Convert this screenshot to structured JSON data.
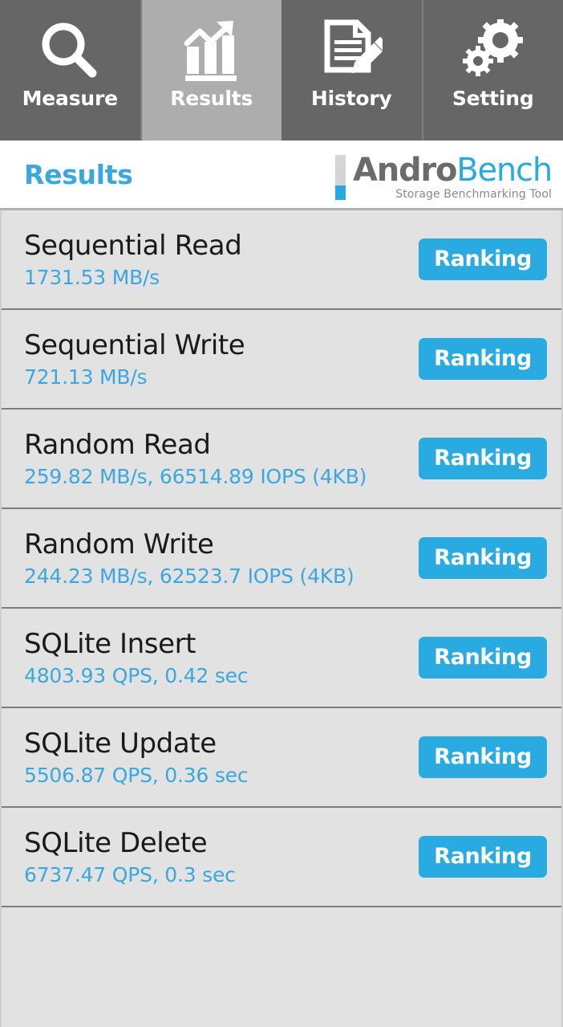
{
  "tabs": [
    {
      "label": "Measure",
      "icon": "magnifier-icon",
      "active": false
    },
    {
      "label": "Results",
      "icon": "bar-chart-icon",
      "active": true
    },
    {
      "label": "History",
      "icon": "document-pencil-icon",
      "active": false
    },
    {
      "label": "Setting",
      "icon": "gears-icon",
      "active": false
    }
  ],
  "header": {
    "title": "Results",
    "logo": {
      "word_primary": "Andro",
      "word_secondary": "Bench",
      "subtitle": "Storage Benchmarking Tool"
    }
  },
  "results": [
    {
      "name": "Sequential Read",
      "value": "1731.53 MB/s",
      "action": "Ranking"
    },
    {
      "name": "Sequential Write",
      "value": "721.13 MB/s",
      "action": "Ranking"
    },
    {
      "name": "Random Read",
      "value": "259.82 MB/s, 66514.89 IOPS (4KB)",
      "action": "Ranking"
    },
    {
      "name": "Random Write",
      "value": "244.23 MB/s, 62523.7 IOPS (4KB)",
      "action": "Ranking"
    },
    {
      "name": "SQLite Insert",
      "value": "4803.93 QPS, 0.42 sec",
      "action": "Ranking"
    },
    {
      "name": "SQLite Update",
      "value": "5506.87 QPS, 0.36 sec",
      "action": "Ranking"
    },
    {
      "name": "SQLite Delete",
      "value": "6737.47 QPS, 0.3 sec",
      "action": "Ranking"
    }
  ],
  "colors": {
    "accent": "#29abe2",
    "value_text": "#3aa8de",
    "tab_bar": "#666666",
    "tab_active": "#adadad",
    "list_background": "#e2e2e2",
    "title_text": "#1a1a1a"
  }
}
